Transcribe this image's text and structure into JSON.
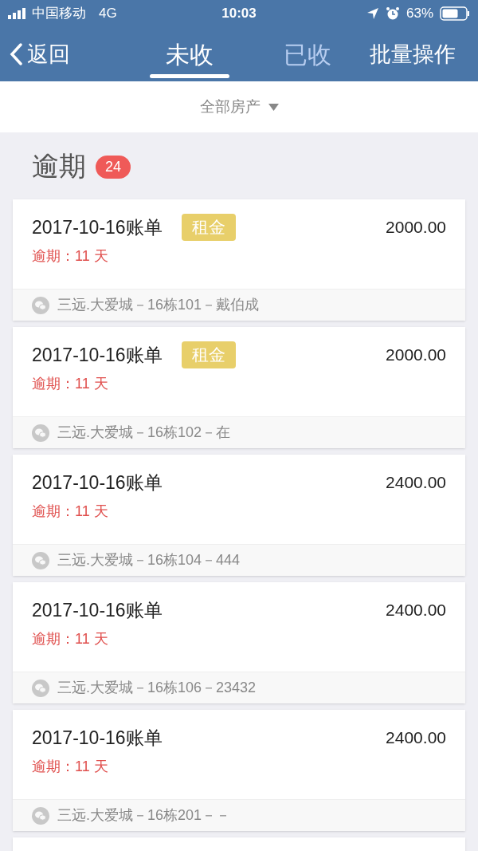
{
  "status_bar": {
    "carrier": "中国移动",
    "network": "4G",
    "time": "10:03",
    "battery": "63%"
  },
  "nav": {
    "back": "返回",
    "tabs": [
      {
        "label": "未收",
        "selected": true
      },
      {
        "label": "已收",
        "selected": false
      }
    ],
    "action": "批量操作"
  },
  "filter": {
    "label": "全部房产"
  },
  "section": {
    "title": "逾期",
    "count": "24"
  },
  "bills": [
    {
      "title": "2017-10-16账单",
      "tag": "租金",
      "amount": "2000.00",
      "overdue": "逾期：11 天",
      "property": "三远.大爱城－16栋101－戴伯成"
    },
    {
      "title": "2017-10-16账单",
      "tag": "租金",
      "amount": "2000.00",
      "overdue": "逾期：11 天",
      "property": "三远.大爱城－16栋102－在"
    },
    {
      "title": "2017-10-16账单",
      "amount": "2400.00",
      "overdue": "逾期：11 天",
      "property": "三远.大爱城－16栋104－444"
    },
    {
      "title": "2017-10-16账单",
      "amount": "2400.00",
      "overdue": "逾期：11 天",
      "property": "三远.大爱城－16栋106－23432"
    },
    {
      "title": "2017-10-16账单",
      "amount": "2400.00",
      "overdue": "逾期：11 天",
      "property": "三远.大爱城－16栋201－－"
    }
  ]
}
